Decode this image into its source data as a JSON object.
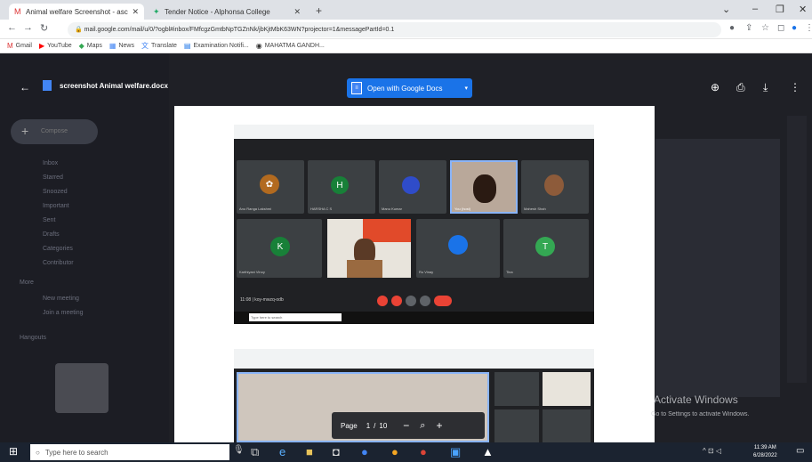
{
  "tabs": [
    {
      "title": "Animal welfare Screenshot - asc",
      "active": true
    },
    {
      "title": "Tender Notice - Alphonsa College",
      "active": false
    }
  ],
  "address": {
    "url": "mail.google.com/mail/u/0/?ogbl#inbox/FMfcgzGmtbNpTGZnNk/jbKjtMbK63WN?projector=1&messagePartId=0.1"
  },
  "bookmarks": [
    "Gmail",
    "YouTube",
    "Maps",
    "News",
    "Translate",
    "Examination Notifi...",
    "MAHATMA GANDH..."
  ],
  "gmail": {
    "compose": "Compose",
    "sidebar": [
      "Inbox",
      "Starred",
      "Snoozed",
      "Important",
      "Sent",
      "Drafts",
      "Categories",
      "Contributor",
      "More",
      "New meeting",
      "Join a meeting",
      "Hangouts"
    ]
  },
  "viewer": {
    "title": "screenshot Animal welfare.docx",
    "open_with": "Open with Google Docs"
  },
  "meet": {
    "tiles": [
      {
        "initial": "",
        "name": "Anu Ranga Lakshmi"
      },
      {
        "initial": "H",
        "name": "HARSHA C S"
      },
      {
        "initial": "",
        "name": "Manu Kumar"
      },
      {
        "initial": "",
        "name": "You (host)"
      },
      {
        "initial": "",
        "name": "Mahesh Shah"
      },
      {
        "initial": "K",
        "name": "Karthiyani Vinoy"
      },
      {
        "initial": "",
        "name": ""
      },
      {
        "initial": "",
        "name": "Ru Vinay"
      },
      {
        "initial": "T",
        "name": "Tina"
      }
    ],
    "time": "11:08 | koy-mwzq-odb",
    "search": "Type here to search"
  },
  "pager": {
    "label": "Page",
    "current": "1",
    "sep": "/",
    "total": "10"
  },
  "watermark": {
    "line1": "Activate Windows",
    "line2": "Go to Settings to activate Windows."
  },
  "taskbar": {
    "search": "Type here to search",
    "time": "11:39 AM",
    "date": "6/28/2022"
  },
  "colors": {
    "avatar_green": "#188038",
    "avatar_green2": "#34a853",
    "open_with_bg": "#1a73e8"
  }
}
